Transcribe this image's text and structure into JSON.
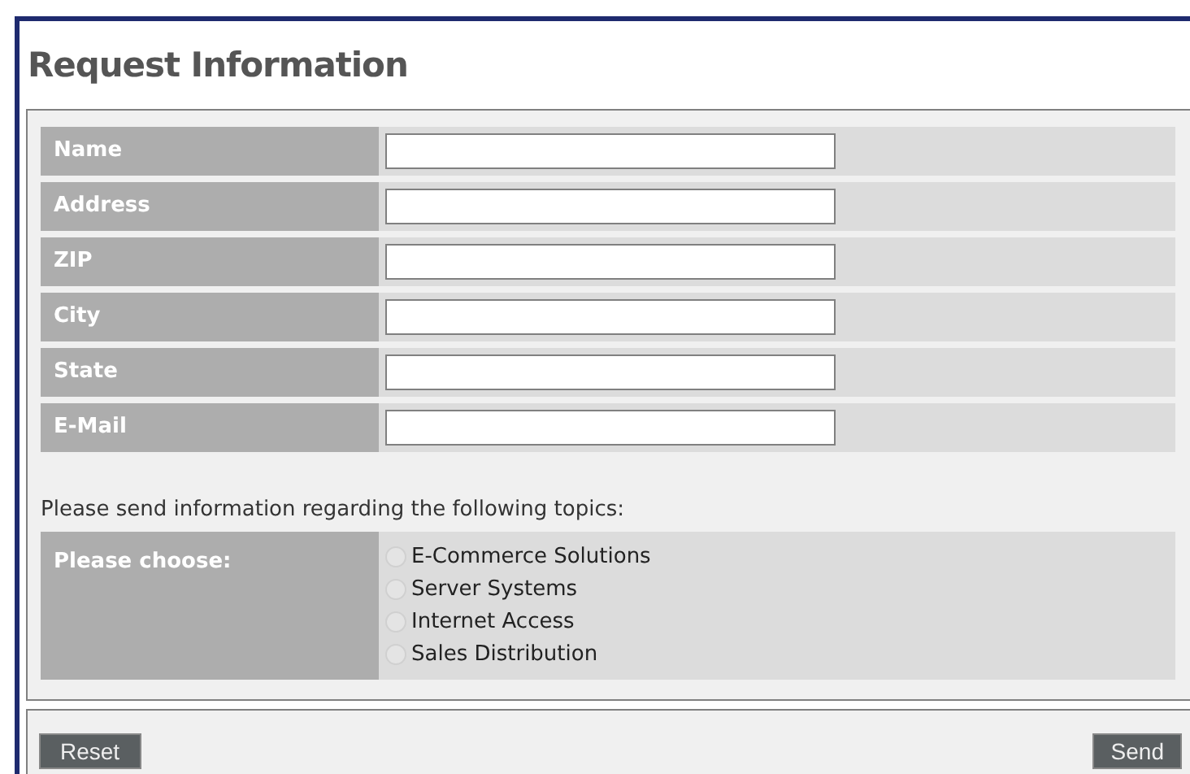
{
  "title": "Request Information",
  "fields": [
    {
      "label": "Name"
    },
    {
      "label": "Address"
    },
    {
      "label": "ZIP"
    },
    {
      "label": "City"
    },
    {
      "label": "State"
    },
    {
      "label": "E-Mail"
    }
  ],
  "topics_prompt": "Please send information regarding the following topics:",
  "choose_label": "Please choose:",
  "topics": [
    {
      "label": "E-Commerce Solutions",
      "selected": false
    },
    {
      "label": "Server Systems",
      "selected": false
    },
    {
      "label": "Internet Access",
      "selected": false
    },
    {
      "label": "Sales Distribution",
      "selected": false
    }
  ],
  "buttons": {
    "reset": "Reset",
    "send": "Send"
  }
}
